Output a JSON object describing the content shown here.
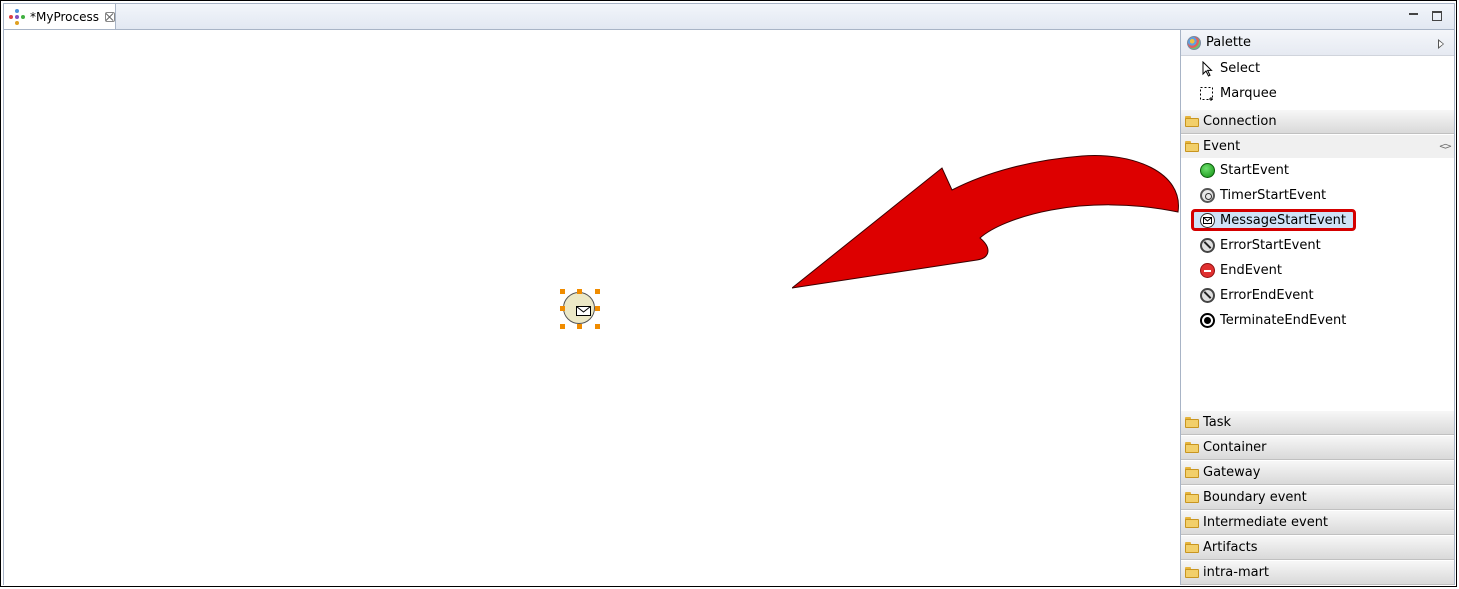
{
  "editor": {
    "tab_title": "*MyProcess",
    "tab_icon": "process-icon",
    "close_icon": "close-icon"
  },
  "canvas": {
    "element": "message-start-event",
    "element_icon": "envelope-icon",
    "annotation": "red-curved-arrow"
  },
  "palette": {
    "title": "Palette",
    "tools": [
      {
        "label": "Select",
        "icon": "select-arrow-icon"
      },
      {
        "label": "Marquee",
        "icon": "marquee-icon"
      }
    ],
    "drawers_top": [
      {
        "label": "Connection",
        "open": false
      },
      {
        "label": "Event",
        "open": true
      }
    ],
    "event_entries": [
      {
        "label": "StartEvent",
        "icon": "start-event-icon"
      },
      {
        "label": "TimerStartEvent",
        "icon": "timer-start-event-icon"
      },
      {
        "label": "MessageStartEvent",
        "icon": "message-start-event-icon",
        "selected": true
      },
      {
        "label": "ErrorStartEvent",
        "icon": "error-start-event-icon"
      },
      {
        "label": "EndEvent",
        "icon": "end-event-icon"
      },
      {
        "label": "ErrorEndEvent",
        "icon": "error-end-event-icon"
      },
      {
        "label": "TerminateEndEvent",
        "icon": "terminate-end-event-icon"
      }
    ],
    "drawers_bottom": [
      {
        "label": "Task"
      },
      {
        "label": "Container"
      },
      {
        "label": "Gateway"
      },
      {
        "label": "Boundary event"
      },
      {
        "label": "Intermediate event"
      },
      {
        "label": "Artifacts"
      },
      {
        "label": "intra-mart"
      }
    ]
  },
  "colors": {
    "highlight_border": "#d40000",
    "arrow_fill": "#dd0000",
    "selection_handle": "#f08c00",
    "event_fill": "#ece8c6"
  }
}
